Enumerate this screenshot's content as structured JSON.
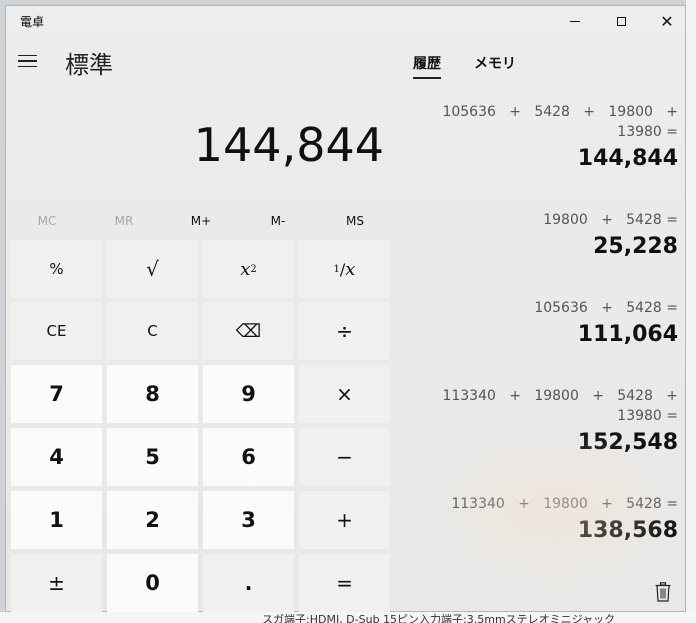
{
  "window": {
    "title": "電卓"
  },
  "header": {
    "mode": "標準"
  },
  "tabs": {
    "history": "履歴",
    "memory": "メモリ"
  },
  "display": {
    "value": "144,844"
  },
  "memory": {
    "mc": "MC",
    "mr": "MR",
    "mplus": "M+",
    "mminus": "M-",
    "ms": "MS"
  },
  "keys": {
    "percent": "%",
    "sqrt": "√",
    "square_base": "x",
    "square_exp": "2",
    "reciprocal_num": "1",
    "reciprocal_den": "x",
    "ce": "CE",
    "c": "C",
    "backspace": "⌫",
    "divide": "÷",
    "seven": "7",
    "eight": "8",
    "nine": "9",
    "multiply": "×",
    "four": "4",
    "five": "5",
    "six": "6",
    "minus": "−",
    "one": "1",
    "two": "2",
    "three": "3",
    "plus": "+",
    "negate": "±",
    "zero": "0",
    "decimal": ".",
    "equals": "="
  },
  "history": [
    {
      "line1": "105636   +   5428   +   19800   +",
      "line2": "13980 =",
      "result": "144,844"
    },
    {
      "line1": "19800   +   5428 =",
      "line2": "",
      "result": "25,228"
    },
    {
      "line1": "105636   +   5428 =",
      "line2": "",
      "result": "111,064"
    },
    {
      "line1": "113340   +   19800   +   5428   +",
      "line2": "13980 =",
      "result": "152,548"
    },
    {
      "line1": "113340   +   19800   +   5428 =",
      "line2": "",
      "result": "138,568"
    }
  ],
  "background_text": "スガ端子:HDMI, D-Sub 15ピン入力端子:3.5mmステレオミニジャック"
}
